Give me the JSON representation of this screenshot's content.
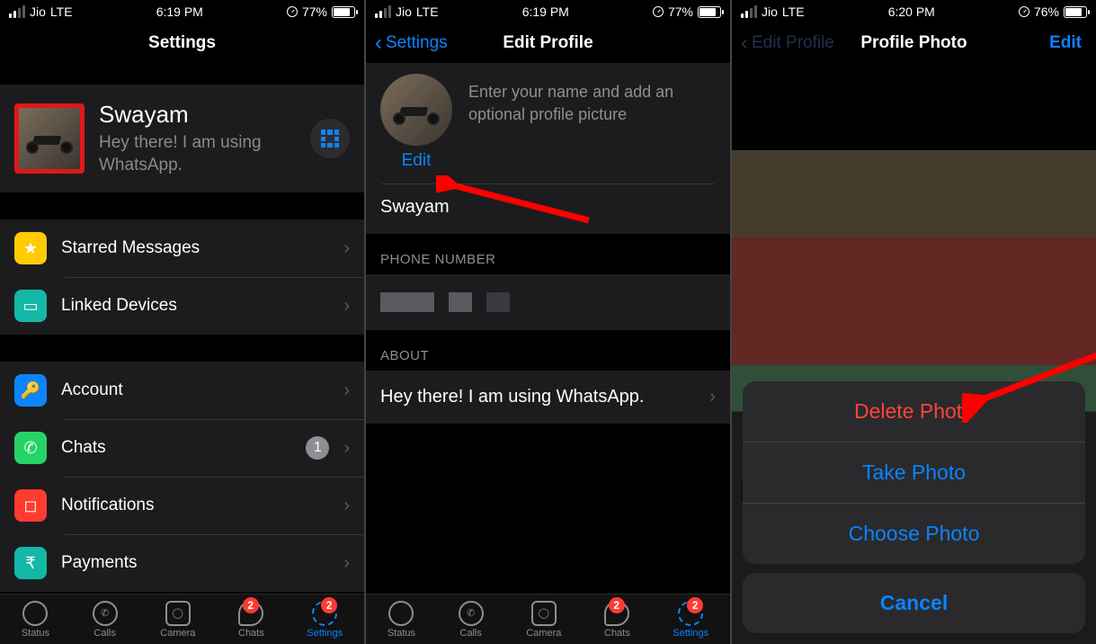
{
  "screen1": {
    "status": {
      "carrier": "Jio",
      "network": "LTE",
      "time": "6:19 PM",
      "battery_pct": "77%",
      "battery_fill": 77
    },
    "nav": {
      "title": "Settings"
    },
    "profile": {
      "name": "Swayam",
      "status": "Hey there! I am using WhatsApp."
    },
    "rows": {
      "starred": "Starred Messages",
      "linked": "Linked Devices",
      "account": "Account",
      "chats": "Chats",
      "chats_badge": "1",
      "notifications": "Notifications",
      "payments": "Payments"
    },
    "tabs": {
      "status": "Status",
      "calls": "Calls",
      "camera": "Camera",
      "chats": "Chats",
      "settings": "Settings",
      "chats_badge": "2",
      "settings_badge": "2"
    }
  },
  "screen2": {
    "status": {
      "carrier": "Jio",
      "network": "LTE",
      "time": "6:19 PM",
      "battery_pct": "77%",
      "battery_fill": 77
    },
    "nav": {
      "back": "Settings",
      "title": "Edit Profile"
    },
    "hint": "Enter your name and add an optional profile picture",
    "edit": "Edit",
    "name": "Swayam",
    "phone_header": "PHONE NUMBER",
    "about_header": "ABOUT",
    "about_text": "Hey there! I am using WhatsApp.",
    "tabs": {
      "status": "Status",
      "calls": "Calls",
      "camera": "Camera",
      "chats": "Chats",
      "settings": "Settings",
      "chats_badge": "2",
      "settings_badge": "2"
    }
  },
  "screen3": {
    "status": {
      "carrier": "Jio",
      "network": "LTE",
      "time": "6:20 PM",
      "battery_pct": "76%",
      "battery_fill": 76
    },
    "nav": {
      "back": "Edit Profile",
      "title": "Profile Photo",
      "right": "Edit"
    },
    "sheet": {
      "delete": "Delete Photo",
      "take": "Take Photo",
      "choose": "Choose Photo",
      "cancel": "Cancel"
    }
  }
}
